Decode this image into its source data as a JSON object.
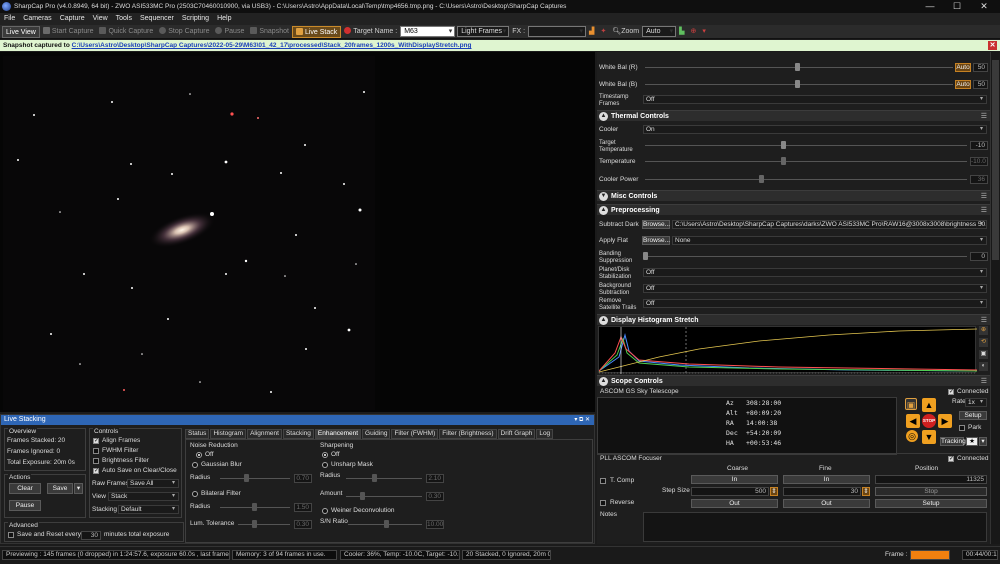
{
  "window": {
    "title": "SharpCap Pro (v4.0.8949, 64 bit) - ZWO ASI533MC Pro (2503C70460010900, via USB3) - C:\\Users\\Astro\\AppData\\Local\\Temp\\tmp4656.tmp.png - C:\\Users\\Astro\\Desktop\\SharpCap Captures",
    "minimize": "—",
    "maximize": "☐",
    "close": "✕"
  },
  "menu": [
    "File",
    "Cameras",
    "Capture",
    "View",
    "Tools",
    "Sequencer",
    "Scripting",
    "Help"
  ],
  "toolbar": {
    "live_view": "Live View",
    "start_capture": "Start Capture",
    "quick_capture": "Quick Capture",
    "stop_capture": "Stop Capture",
    "pause": "Pause",
    "snapshot": "Snapshot",
    "live_stack": "Live Stack",
    "target_label": "Target Name :",
    "target_value": "M63",
    "frame_type": "Light Frames",
    "fx_label": "FX :",
    "fx_value": "",
    "zoom_label": "Zoom",
    "zoom_value": "Auto"
  },
  "snapshot_notice": {
    "prefix": "Snapshot captured to",
    "path": "C:\\Users\\Astro\\Desktop\\SharpCap Captures\\2022-05-29\\M63\\01_42_17\\processed\\Stack_20frames_1200s_WithDisplayStretch.png"
  },
  "right_panel": {
    "white_bal_r": {
      "label": "White Bal (R)",
      "auto": "Auto",
      "value": "50"
    },
    "white_bal_b": {
      "label": "White Bal (B)",
      "auto": "Auto",
      "value": "50"
    },
    "timestamp": {
      "label": "Timestamp Frames",
      "value": "Off"
    },
    "thermal": {
      "title": "Thermal Controls",
      "cooler_label": "Cooler",
      "cooler_value": "On",
      "target_temp_label": "Target Temperature",
      "target_temp_value": "-10",
      "temperature_label": "Temperature",
      "temperature_value": "-10.0",
      "cooler_power_label": "Cooler Power",
      "cooler_power_value": "36"
    },
    "misc_title": "Misc Controls",
    "preprocessing": {
      "title": "Preprocessing",
      "subtract_dark_label": "Subtract Dark",
      "browse": "Browse...",
      "subtract_dark_value": "C:\\Users\\Astro\\Desktop\\SharpCap Captures\\darks\\ZWO ASI533MC Pro\\RAW16@3008x3008\\brightness 50...",
      "apply_flat_label": "Apply Flat",
      "apply_flat_value": "None",
      "banding_label": "Banding Suppression",
      "banding_value": "0",
      "planet_label": "Planet/Disk Stabilization",
      "planet_value": "Off",
      "background_label": "Background Subtraction",
      "background_value": "Off",
      "satellite_label": "Remove Satellite Trails",
      "satellite_value": "Off"
    },
    "histogram_title": "Display Histogram Stretch",
    "scope": {
      "title": "Scope Controls",
      "connected": "Connected",
      "mount_name": "ASCOM GS Sky Telescope",
      "az_label": "Az",
      "az": "308:28:00",
      "alt_label": "Alt",
      "alt": "+80:09:20",
      "ra_label": "RA",
      "ra": "14:00:38",
      "dec_label": "Dec",
      "dec": "+54:20:09",
      "ha_label": "HA",
      "ha": "+00:53:46",
      "rate_label": "Rate",
      "rate_value": "1x",
      "setup": "Setup",
      "park": "Park",
      "tracking": "Tracking",
      "stop": "STOP"
    },
    "focuser": {
      "name": "PLL ASCOM Focuser",
      "connected": "Connected",
      "tcomp": "T. Comp",
      "coarse": "Coarse",
      "fine": "Fine",
      "position": "Position",
      "in": "In",
      "out": "Out",
      "step_size": "Step Size",
      "coarse_step": "500",
      "fine_step": "30",
      "position_value": "11325",
      "stop": "Stop",
      "setup": "Setup",
      "reverse": "Reverse",
      "notes": "Notes"
    }
  },
  "live_stacking": {
    "title": "Live Stacking",
    "overview_title": "Overview",
    "frames_stacked": "Frames Stacked: 20",
    "frames_ignored": "Frames Ignored: 0",
    "total_exposure": "Total Exposure: 20m 0s",
    "actions_title": "Actions",
    "clear": "Clear",
    "save": "Save",
    "pause": "Pause",
    "advanced_title": "Advanced",
    "save_reset": "Save and Reset every",
    "save_reset_value": "30",
    "minutes_total": "minutes total exposure",
    "controls_title": "Controls",
    "align_frames": "Align Frames",
    "fwhm_filter": "FWHM Filter",
    "brightness_filter": "Brightness Filter",
    "auto_save": "Auto Save on Clear/Close",
    "raw_frames_label": "Raw Frames",
    "raw_frames_value": "Save All",
    "view_label": "View",
    "view_value": "Stack",
    "stacking_label": "Stacking",
    "stacking_value": "Default",
    "tabs": [
      "Status",
      "Histogram",
      "Alignment",
      "Stacking",
      "Enhancement",
      "Guiding",
      "Filter (FWHM)",
      "Filter (Brightness)",
      "Drift Graph",
      "Log"
    ],
    "noise_reduction": {
      "title": "Noise Reduction",
      "off": "Off",
      "gaussian": "Gaussian Blur",
      "radius_label": "Radius",
      "radius_value": "0.70",
      "bilateral": "Bilateral Filter",
      "b_radius_label": "Radius",
      "b_radius_value": "1.50",
      "lum_label": "Lum. Tolerance",
      "lum_value": "0.30"
    },
    "sharpening": {
      "title": "Sharpening",
      "off": "Off",
      "unsharp": "Unsharp Mask",
      "radius_label": "Radius",
      "radius_value": "2.10",
      "amount_label": "Amount",
      "amount_value": "0.30",
      "weiner": "Weiner Deconvolution",
      "sn_label": "S/N Ratio",
      "sn_value": "10.00"
    }
  },
  "status": {
    "previewing": "Previewing : 145 frames (0 dropped) in 1:24:57.6, exposure 60.0s , last frame 60.1s",
    "memory": "Memory: 3 of 94 frames in use.",
    "cooler": "Cooler: 36%, Temp: -10.0C, Target: -10.0C",
    "stacked": "20 Stacked, 0 Ignored, 20m 0s",
    "frame_label": "Frame :",
    "frame_progress": 1.0,
    "elapsed": "00:44/00:16"
  }
}
